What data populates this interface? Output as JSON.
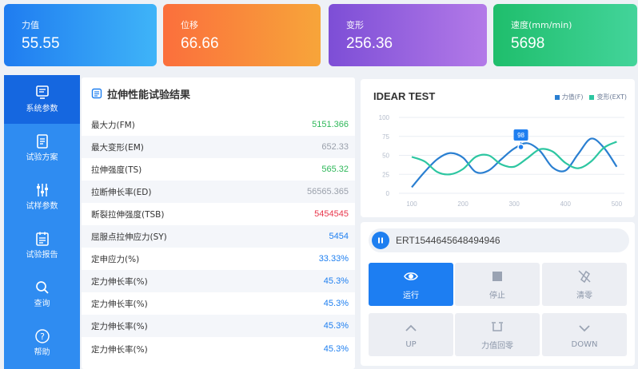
{
  "metrics": [
    {
      "label": "力值",
      "value": "55.55"
    },
    {
      "label": "位移",
      "value": "66.66"
    },
    {
      "label": "变形",
      "value": "256.36"
    },
    {
      "label": "速度(mm/min)",
      "value": "5698"
    }
  ],
  "sidebar": {
    "items": [
      {
        "label": "系统参数",
        "icon": "monitor-icon",
        "active": true
      },
      {
        "label": "试验方案",
        "icon": "document-icon"
      },
      {
        "label": "试样参数",
        "icon": "sliders-icon"
      },
      {
        "label": "试验报告",
        "icon": "report-icon"
      },
      {
        "label": "查询",
        "icon": "search-icon"
      },
      {
        "label": "帮助",
        "icon": "help-icon"
      }
    ]
  },
  "results": {
    "title": "拉伸性能试验结果",
    "rows": [
      {
        "label": "最大力(FM)",
        "value": "5151.366",
        "color": "#2fb85a"
      },
      {
        "label": "最大变形(EM)",
        "value": "652.33",
        "color": "#9aa0ab"
      },
      {
        "label": "拉伸强度(TS)",
        "value": "565.32",
        "color": "#2fb85a"
      },
      {
        "label": "拉断伸长率(ED)",
        "value": "56565.365",
        "color": "#9aa0ab"
      },
      {
        "label": "断裂拉伸强度(TSB)",
        "value": "5454545",
        "color": "#e8364b"
      },
      {
        "label": "屈服点拉伸应力(SY)",
        "value": "5454",
        "color": "#1e7ff0"
      },
      {
        "label": "定申应力(%)",
        "value": "33.33%",
        "color": "#1e7ff0"
      },
      {
        "label": "定力伸长率(%)",
        "value": "45.3%",
        "color": "#1e7ff0"
      },
      {
        "label": "定力伸长率(%)",
        "value": "45.3%",
        "color": "#1e7ff0"
      },
      {
        "label": "定力伸长率(%)",
        "value": "45.3%",
        "color": "#1e7ff0"
      },
      {
        "label": "定力伸长率(%)",
        "value": "45.3%",
        "color": "#1e7ff0"
      }
    ]
  },
  "chart": {
    "title": "IDEAR TEST",
    "legend": [
      "力值(F)",
      "变形(EXT)"
    ],
    "tooltip": "98"
  },
  "chart_data": {
    "type": "line",
    "title": "IDEAR TEST",
    "x_ticks": [
      100,
      200,
      300,
      400,
      500
    ],
    "y_ticks": [
      0,
      25,
      50,
      75,
      100
    ],
    "xlim": [
      75,
      515
    ],
    "ylim": [
      0,
      100
    ],
    "grid": true,
    "legend_position": "top-right",
    "series": [
      {
        "name": "力值(F)",
        "color": "#2a7fd1",
        "x": [
          100,
          125,
          150,
          175,
          200,
          225,
          250,
          275,
          300,
          325,
          350,
          375,
          400,
          425,
          450,
          475,
          500
        ],
        "y": [
          8,
          28,
          45,
          53,
          47,
          28,
          30,
          45,
          59,
          66,
          56,
          34,
          30,
          52,
          72,
          60,
          35
        ]
      },
      {
        "name": "变形(EXT)",
        "color": "#2dc6a1",
        "x": [
          100,
          125,
          150,
          175,
          200,
          225,
          250,
          275,
          300,
          325,
          350,
          375,
          400,
          425,
          450,
          475,
          500
        ],
        "y": [
          48,
          42,
          28,
          25,
          32,
          48,
          50,
          38,
          35,
          46,
          58,
          55,
          40,
          33,
          42,
          60,
          68
        ]
      }
    ],
    "tooltip_point": {
      "x": 313,
      "y": 61,
      "label": "98"
    }
  },
  "control": {
    "test_id": "ERT1544645648494946",
    "buttons": [
      {
        "label": "运行",
        "icon": "eye-icon",
        "primary": true
      },
      {
        "label": "停止",
        "icon": "stop-icon"
      },
      {
        "label": "清零",
        "icon": "clear-icon"
      },
      {
        "label": "UP",
        "icon": "chevron-up-icon"
      },
      {
        "label": "力值回零",
        "icon": "force-reset-icon"
      },
      {
        "label": "DOWN",
        "icon": "chevron-down-icon"
      }
    ]
  },
  "colors": {
    "accent": "#1e7ff0",
    "sidebar": "#2f8cf1",
    "sidebar_active": "#1567e0"
  }
}
